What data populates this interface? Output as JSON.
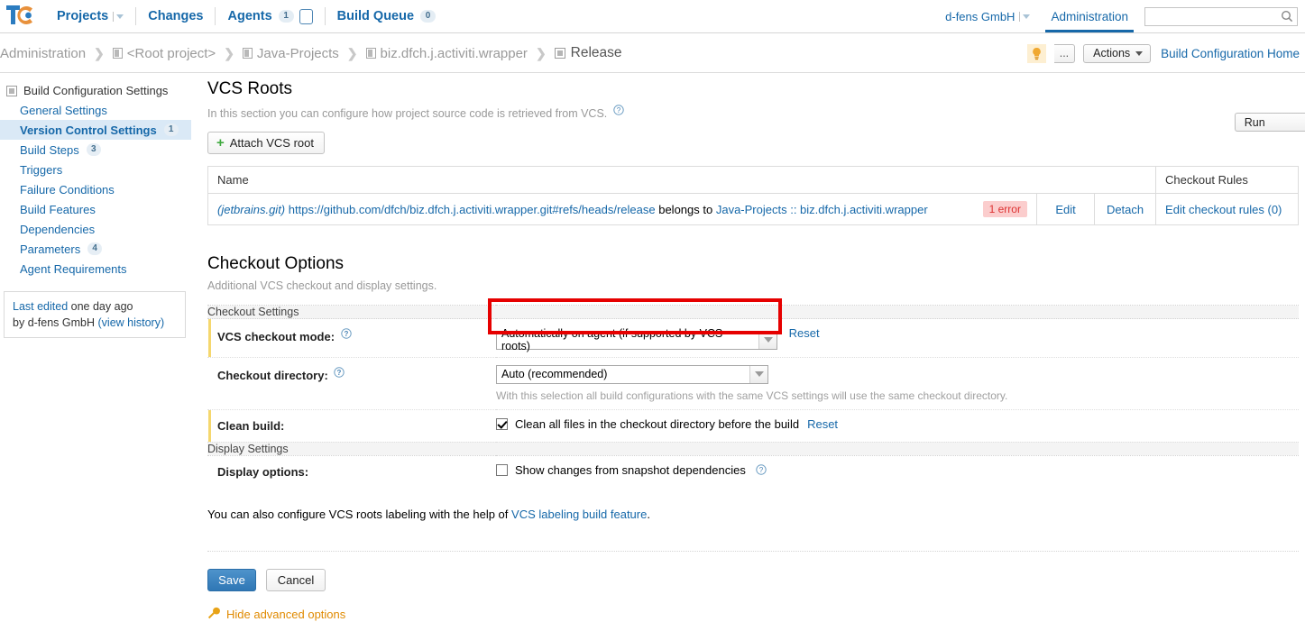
{
  "header": {
    "logo_alt": "teamcity-logo",
    "nav": [
      {
        "label": "Projects",
        "has_dropdown": true
      },
      {
        "label": "Changes",
        "has_dropdown": false
      },
      {
        "label": "Agents",
        "count": "1",
        "has_box": true
      },
      {
        "label": "Build Queue",
        "count": "0"
      }
    ],
    "user": "d-fens GmbH",
    "admin_tab": "Administration",
    "search_placeholder": ""
  },
  "breadcrumb": {
    "items": [
      {
        "label": "Administration",
        "icon": null
      },
      {
        "label": "<Root project>",
        "icon": "project-icon"
      },
      {
        "label": "Java-Projects",
        "icon": "project-icon"
      },
      {
        "label": "biz.dfch.j.activiti.wrapper",
        "icon": "project-icon"
      },
      {
        "label": "Release",
        "icon": "build-config-icon"
      }
    ],
    "separator": "❯",
    "actions": {
      "bulb_icon": "lightbulb-icon",
      "run_label": "Run",
      "run_more": "...",
      "actions_label": "Actions",
      "home_link": "Build Configuration Home"
    }
  },
  "sidebar": {
    "root_label": "Build Configuration Settings",
    "items": [
      {
        "label": "General Settings",
        "count": null,
        "active": false
      },
      {
        "label": "Version Control Settings",
        "count": "1",
        "active": true
      },
      {
        "label": "Build Steps",
        "count": "3",
        "active": false
      },
      {
        "label": "Triggers",
        "count": null,
        "active": false
      },
      {
        "label": "Failure Conditions",
        "count": null,
        "active": false
      },
      {
        "label": "Build Features",
        "count": null,
        "active": false
      },
      {
        "label": "Dependencies",
        "count": null,
        "active": false
      },
      {
        "label": "Parameters",
        "count": "4",
        "active": false
      },
      {
        "label": "Agent Requirements",
        "count": null,
        "active": false
      }
    ],
    "last_edited": {
      "link": "Last edited",
      "time": "one day ago",
      "by_prefix": "by",
      "by": "d-fens GmbH",
      "history_link": "(view history)"
    }
  },
  "vcs_roots": {
    "title": "VCS Roots",
    "description": "In this section you can configure how project source code is retrieved from VCS.",
    "attach_button": "Attach VCS root",
    "columns": [
      "Name",
      "Checkout Rules"
    ],
    "rows": [
      {
        "type": "(jetbrains.git)",
        "url": "https://github.com/dfch/biz.dfch.j.activiti.wrapper.git#refs/heads/release",
        "belongs_prefix": "belongs to",
        "belongs_to": "Java-Projects :: biz.dfch.j.activiti.wrapper",
        "error_badge": "1 error",
        "edit": "Edit",
        "detach": "Detach",
        "checkout_rules": "Edit checkout rules (0)"
      }
    ]
  },
  "checkout_options": {
    "title": "Checkout Options",
    "description": "Additional VCS checkout and display settings.",
    "group_checkout": "Checkout Settings",
    "group_display": "Display Settings",
    "checkout_mode": {
      "label": "VCS checkout mode:",
      "value": "Automatically on agent (if supported by VCS roots)",
      "reset": "Reset",
      "highlighted": true
    },
    "checkout_directory": {
      "label": "Checkout directory:",
      "value": "Auto (recommended)",
      "hint": "With this selection all build configurations with the same VCS settings will use the same checkout directory."
    },
    "clean_build": {
      "label": "Clean build:",
      "checkbox_label": "Clean all files in the checkout directory before the build",
      "checked": true,
      "reset": "Reset"
    },
    "display_options": {
      "label": "Display options:",
      "checkbox_label": "Show changes from snapshot dependencies",
      "checked": false
    },
    "also_text_prefix": "You can also configure VCS roots labeling with the help of",
    "also_link": "VCS labeling build feature",
    "also_text_suffix": "."
  },
  "footer": {
    "save": "Save",
    "cancel": "Cancel",
    "hide_advanced": "Hide advanced options",
    "wrench_icon": "wrench-icon"
  },
  "colors": {
    "link": "#1668a9",
    "accent_orange": "#e08a00",
    "highlight_red": "#e60000",
    "error_badge_bg": "#fbcdcd",
    "modified_marker": "#f5d76e",
    "active_sidebar_bg": "#dae9f6"
  }
}
